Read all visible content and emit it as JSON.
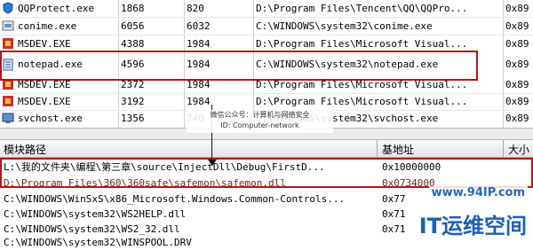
{
  "process_list": {
    "rows": [
      {
        "name": "QQProtect.exe",
        "pid": "1868",
        "ppid": "820",
        "path": "D:\\Program Files\\Tencent\\QQ\\QQPro...",
        "base": "0x89"
      },
      {
        "name": "conime.exe",
        "pid": "6056",
        "ppid": "6032",
        "path": "C:\\WINDOWS\\system32\\conime.exe",
        "base": "0x89"
      },
      {
        "name": "MSDEV.EXE",
        "pid": "4388",
        "ppid": "1984",
        "path": "D:\\Program Files\\Microsoft Visual...",
        "base": "0x89"
      },
      {
        "name": "notepad.exe",
        "pid": "4596",
        "ppid": "1984",
        "path": "C:\\WINDOWS\\system32\\notepad.exe",
        "base": "0x89"
      },
      {
        "name": "MSDEV.EXE",
        "pid": "2372",
        "ppid": "1984",
        "path": "D:\\Program Files\\Microsoft Visual...",
        "base": "0x89"
      },
      {
        "name": "MSDEV.EXE",
        "pid": "3192",
        "ppid": "1984",
        "path": "D:\\Program Files\\Microsoft Visual...",
        "base": "0x89"
      },
      {
        "name": "svchost.exe",
        "pid": "1356",
        "ppid": "740",
        "path": "C:\\WINDOWS\\system32\\svchost.exe",
        "base": "0x89"
      }
    ]
  },
  "watermark": {
    "line1": "微信公众号：计算机与网络安全",
    "line2": "ID: Computer-network"
  },
  "module_list": {
    "headers": {
      "path": "模块路径",
      "base": "基地址",
      "size": "大小"
    },
    "rows": [
      {
        "path": "L:\\我的文件夹\\编程\\第三章\\source\\InjectDll\\Debug\\FirstD...",
        "base": "0x10000000",
        "size": ""
      },
      {
        "path": "D:\\Program Files\\360\\360safe\\safemon\\safemon.dll",
        "base": "0x0734000",
        "size": ""
      },
      {
        "path": "C:\\WINDOWS\\WinSxS\\x86_Microsoft.Windows.Common-Controls...",
        "base": "0x77",
        "size": ""
      },
      {
        "path": "C:\\WINDOWS\\system32\\WS2HELP.dll",
        "base": "0x71",
        "size": ""
      },
      {
        "path": "C:\\WINDOWS\\system32\\WS2_32.dll",
        "base": "0x71",
        "size": ""
      },
      {
        "path": "C:\\WINDOWS\\system32\\WINSPOOL.DRV",
        "base": "",
        "size": ""
      }
    ]
  },
  "logo": {
    "site": "www.94IP.com",
    "brand": "IT运维空间"
  },
  "colors": {
    "highlight": "#b01818",
    "brand": "#1d5fb5"
  }
}
